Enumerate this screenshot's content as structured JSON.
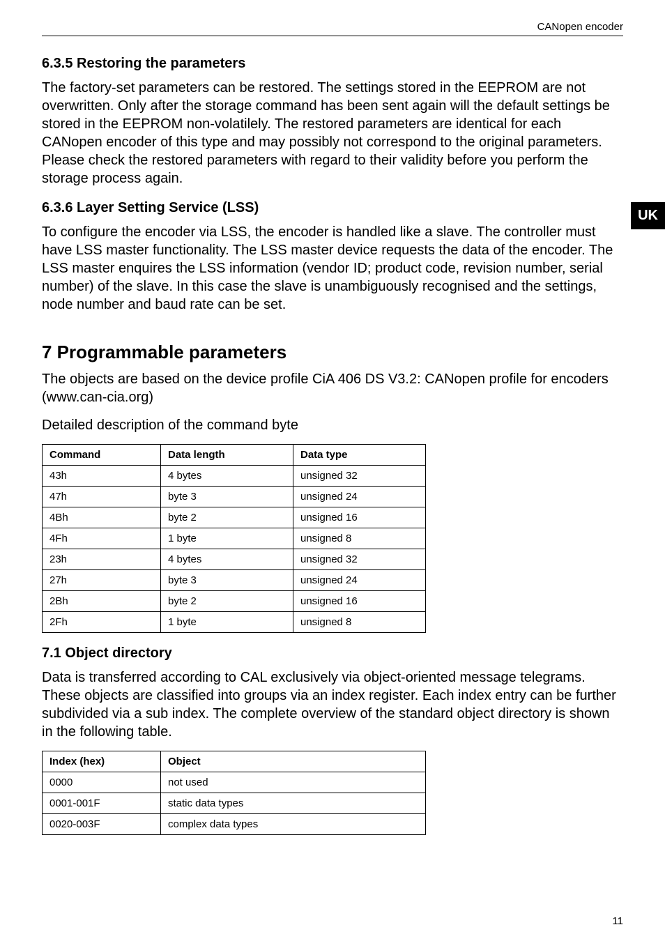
{
  "header": "CANopen encoder",
  "side_tab": "UK",
  "page_number": "11",
  "s635": {
    "heading": "6.3.5  Restoring the parameters",
    "body": "The factory-set parameters can be restored. The settings stored in the EEPROM are not overwritten. Only after the storage command has been sent again will the default settings be stored in the EEPROM non-volatilely. The restored parameters are identical for each CANopen encoder of this type and may possibly not correspond to the original parameters. Please check the restored parameters with regard to their validity before you perform the storage process again."
  },
  "s636": {
    "heading": "6.3.6  Layer Setting Service (LSS)",
    "body": "To configure the encoder via LSS, the encoder is handled like a slave. The controller must have LSS master functionality. The LSS master device requests the data of the encoder. The LSS master enquires the LSS information (vendor ID; product code, revision number, serial number) of the slave. In this case the slave is unambiguously recognised and the settings, node number and baud rate can be set."
  },
  "s7": {
    "heading": "7  Programmable parameters",
    "intro": "The objects are based on the device profile CiA 406 DS V3.2: CANopen profile for encoders (www.can-cia.org)",
    "table_intro": "Detailed description of the command byte",
    "table1_headers": {
      "c1": "Command",
      "c2": "Data length",
      "c3": "Data type"
    },
    "table1_rows": [
      {
        "c1": "43h",
        "c2": "4 bytes",
        "c3": "unsigned 32"
      },
      {
        "c1": "47h",
        "c2": "byte 3",
        "c3": "unsigned 24"
      },
      {
        "c1": "4Bh",
        "c2": "byte 2",
        "c3": "unsigned 16"
      },
      {
        "c1": "4Fh",
        "c2": "1 byte",
        "c3": "unsigned 8"
      },
      {
        "c1": "23h",
        "c2": "4 bytes",
        "c3": "unsigned 32"
      },
      {
        "c1": "27h",
        "c2": "byte 3",
        "c3": "unsigned 24"
      },
      {
        "c1": "2Bh",
        "c2": "byte 2",
        "c3": "unsigned 16"
      },
      {
        "c1": "2Fh",
        "c2": "1 byte",
        "c3": "unsigned 8"
      }
    ]
  },
  "s71": {
    "heading": "7.1  Object directory",
    "body": "Data is transferred according to CAL exclusively via object-oriented message telegrams. These objects are classified into groups via an index register. Each index entry can be further subdivided via a sub index. The complete overview of the standard object directory is shown in the following table.",
    "table2_headers": {
      "c1": "Index (hex)",
      "c2": "Object"
    },
    "table2_rows": [
      {
        "c1": "0000",
        "c2": "not used"
      },
      {
        "c1": "0001-001F",
        "c2": "static data types"
      },
      {
        "c1": "0020-003F",
        "c2": "complex data types"
      }
    ]
  }
}
